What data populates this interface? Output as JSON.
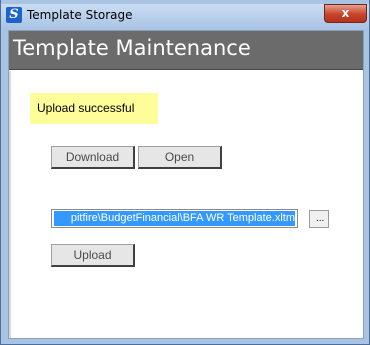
{
  "window": {
    "title": "Template Storage",
    "icon_letter": "S",
    "close_label": "x"
  },
  "header": {
    "title": "Template Maintenance"
  },
  "status": {
    "message": "Upload successful"
  },
  "buttons": {
    "download_label": "Download",
    "open_label": "Open",
    "upload_label": "Upload",
    "browse_label": "..."
  },
  "file": {
    "path_visible": "pitfire\\BudgetFinancial\\BFA WR Template.xltm"
  },
  "colors": {
    "header_bg": "#6b6b6b",
    "status_bg": "#fdfd9a",
    "selection": "#3399ff",
    "close_button": "#c7432b"
  }
}
